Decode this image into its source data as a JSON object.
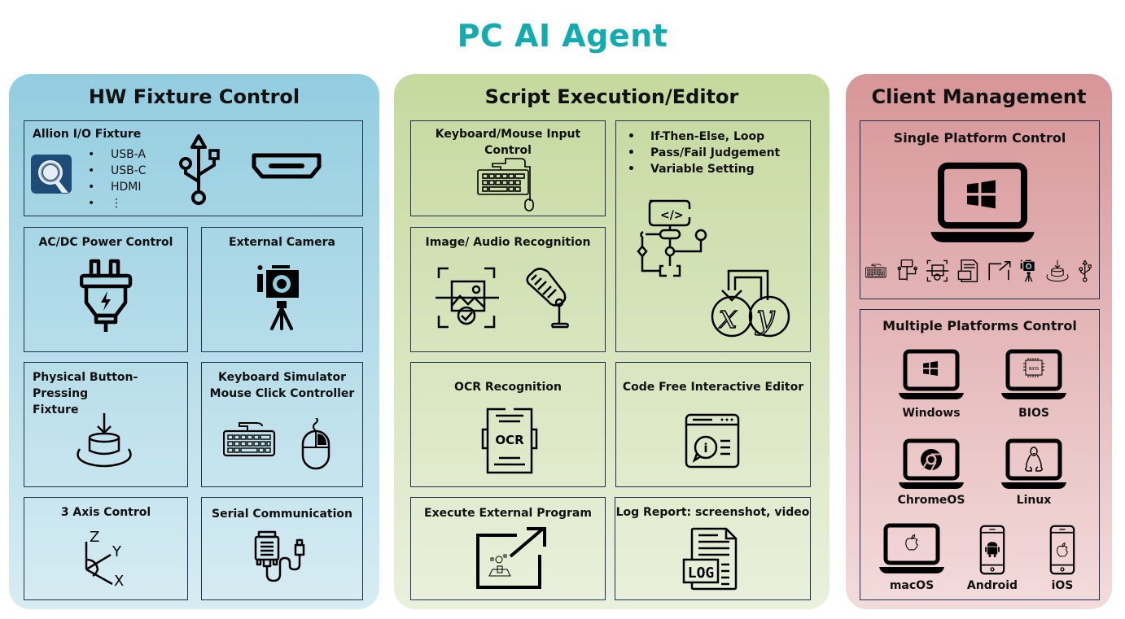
{
  "title": "PC AI Agent",
  "colors": {
    "title": "#12acb0",
    "hw_panel": "#93cde0",
    "script_panel": "#c5d99e",
    "client_panel": "#d79698",
    "box_border": "#1f2f4f"
  },
  "hw": {
    "title": "HW Fixture Control",
    "io_fixture": {
      "title": "Allion I/O Fixture",
      "items": [
        "USB-A",
        "USB-C",
        "HDMI",
        "⋮"
      ],
      "icons": [
        "allion-logo-icon",
        "usb-icon",
        "hdmi-port-icon"
      ]
    },
    "power": {
      "title": "AC/DC Power Control",
      "icon": "power-plug-icon"
    },
    "camera": {
      "title": "External Camera",
      "icon": "camera-tripod-icon"
    },
    "button": {
      "title": "Physical Button-Pressing Fixture",
      "title_line1": "Physical Button-Pressing",
      "title_line2": "Fixture",
      "icon": "button-press-icon"
    },
    "kbsim": {
      "title_line1": "Keyboard Simulator",
      "title_line2": "Mouse Click Controller",
      "icons": [
        "keyboard-icon",
        "mouse-icon"
      ]
    },
    "axis": {
      "title": "3 Axis  Control",
      "labels": [
        "Z",
        "Y",
        "X"
      ],
      "icon": "three-axis-icon"
    },
    "serial": {
      "title": "Serial Communication",
      "icon": "serial-cable-icon"
    }
  },
  "script": {
    "title": "Script Execution/Editor",
    "kb_input": {
      "title": "Keyboard/Mouse Input Control",
      "icon": "keyboard-mouse-icon"
    },
    "logic": {
      "items": [
        "If-Then-Else, Loop",
        "Pass/Fail Judgement",
        "Variable Setting"
      ],
      "icons": [
        "flowchart-icon",
        "variable-xy-icon"
      ],
      "code_glyph": "</>",
      "var_x": "x",
      "var_y": "y"
    },
    "recognition": {
      "title": "Image/ Audio Recognition",
      "icons": [
        "image-scan-icon",
        "microphone-icon"
      ]
    },
    "ocr": {
      "title": "OCR Recognition",
      "icon": "ocr-icon",
      "icon_text": "OCR"
    },
    "editor": {
      "title": "Code Free Interactive Editor",
      "icon": "interactive-editor-icon",
      "icon_text": "i"
    },
    "external": {
      "title": "Execute External Program",
      "icon": "external-program-icon"
    },
    "log": {
      "title": "Log Report: screenshot, video",
      "icon": "log-file-icon",
      "icon_text": "LOG"
    }
  },
  "client": {
    "title": "Client Management",
    "single": {
      "title": "Single Platform Control",
      "icon": "windows-laptop-icon",
      "feature_icons": [
        "keyboard-mouse-icon",
        "flowchart-icon",
        "image-scan-icon",
        "log-file-icon",
        "external-program-icon",
        "camera-tripod-icon",
        "button-press-icon",
        "usb-icon"
      ]
    },
    "multi": {
      "title": "Multiple Platforms Control",
      "platforms": [
        {
          "label": "Windows",
          "icon": "windows-laptop-icon"
        },
        {
          "label": "BIOS",
          "icon": "bios-laptop-icon",
          "chip_text": "BIOS"
        },
        {
          "label": "ChromeOS",
          "icon": "chrome-laptop-icon"
        },
        {
          "label": "Linux",
          "icon": "linux-laptop-icon"
        },
        {
          "label": "macOS",
          "icon": "mac-laptop-icon"
        },
        {
          "label": "Android",
          "icon": "android-phone-icon"
        },
        {
          "label": "iOS",
          "icon": "ios-phone-icon"
        }
      ]
    }
  }
}
